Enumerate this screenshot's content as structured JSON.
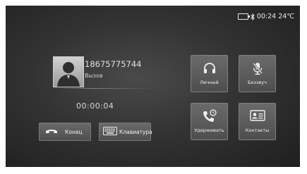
{
  "status_bar": {
    "time": "00:24",
    "temperature": "24℃",
    "icons": [
      "battery-icon",
      "bluetooth-icon"
    ]
  },
  "caller": {
    "number": "18675775744",
    "state": "Вызов",
    "avatar_icon": "person-silhouette-icon"
  },
  "call_timer": "00:00:04",
  "buttons": {
    "end": "Конец",
    "keyboard": "Клавиатура"
  },
  "tiles": [
    {
      "label": "Личный",
      "icon": "headset-icon"
    },
    {
      "label": "Беззвуч",
      "icon": "mute-microphone-icon"
    },
    {
      "label": "Удерживать",
      "icon": "hold-phone-icon"
    },
    {
      "label": "Контакты",
      "icon": "contact-card-icon"
    }
  ]
}
